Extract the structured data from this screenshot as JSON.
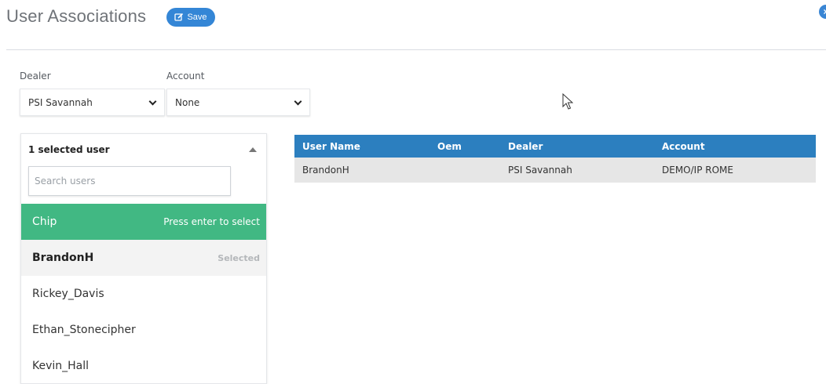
{
  "header": {
    "title": "User Associations",
    "save_label": "Save",
    "save_icon": "edit-icon",
    "close_icon": "close-icon"
  },
  "filters": {
    "dealer_label": "Dealer",
    "dealer_value": "PSI Savannah",
    "account_label": "Account",
    "account_value": "None"
  },
  "user_panel": {
    "selected_count": "1 selected user",
    "search_placeholder": "Search users",
    "users": [
      {
        "name": "Chip",
        "hint": "Press enter to select"
      },
      {
        "name": "BrandonH",
        "hint": "Selected"
      },
      {
        "name": "Rickey_Davis",
        "hint": ""
      },
      {
        "name": "Ethan_Stonecipher",
        "hint": ""
      },
      {
        "name": "Kevin_Hall",
        "hint": ""
      }
    ]
  },
  "table": {
    "columns": [
      "User Name",
      "Oem",
      "Dealer",
      "Account"
    ],
    "rows": [
      [
        "BrandonH",
        "",
        "PSI Savannah",
        "DEMO/IP ROME"
      ]
    ]
  },
  "colors": {
    "accent": "#3486d6",
    "table_header": "#2c7fbf",
    "highlight": "#41b883",
    "selected_row": "#f3f3f3"
  }
}
